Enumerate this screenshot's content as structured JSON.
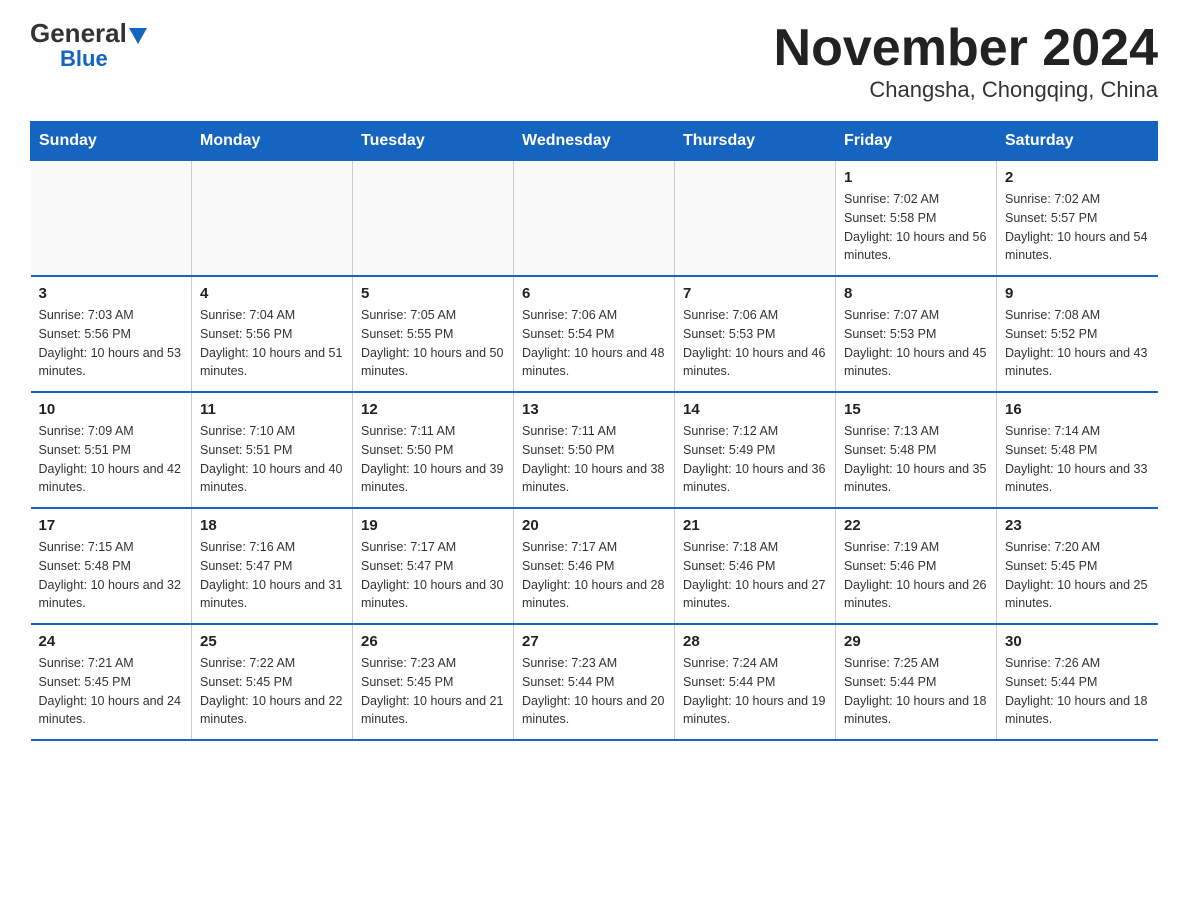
{
  "header": {
    "logo_general": "General",
    "logo_arrow": "",
    "logo_blue": "Blue",
    "title": "November 2024",
    "subtitle": "Changsha, Chongqing, China"
  },
  "weekdays": [
    "Sunday",
    "Monday",
    "Tuesday",
    "Wednesday",
    "Thursday",
    "Friday",
    "Saturday"
  ],
  "weeks": [
    [
      {
        "day": "",
        "info": ""
      },
      {
        "day": "",
        "info": ""
      },
      {
        "day": "",
        "info": ""
      },
      {
        "day": "",
        "info": ""
      },
      {
        "day": "",
        "info": ""
      },
      {
        "day": "1",
        "info": "Sunrise: 7:02 AM\nSunset: 5:58 PM\nDaylight: 10 hours and 56 minutes."
      },
      {
        "day": "2",
        "info": "Sunrise: 7:02 AM\nSunset: 5:57 PM\nDaylight: 10 hours and 54 minutes."
      }
    ],
    [
      {
        "day": "3",
        "info": "Sunrise: 7:03 AM\nSunset: 5:56 PM\nDaylight: 10 hours and 53 minutes."
      },
      {
        "day": "4",
        "info": "Sunrise: 7:04 AM\nSunset: 5:56 PM\nDaylight: 10 hours and 51 minutes."
      },
      {
        "day": "5",
        "info": "Sunrise: 7:05 AM\nSunset: 5:55 PM\nDaylight: 10 hours and 50 minutes."
      },
      {
        "day": "6",
        "info": "Sunrise: 7:06 AM\nSunset: 5:54 PM\nDaylight: 10 hours and 48 minutes."
      },
      {
        "day": "7",
        "info": "Sunrise: 7:06 AM\nSunset: 5:53 PM\nDaylight: 10 hours and 46 minutes."
      },
      {
        "day": "8",
        "info": "Sunrise: 7:07 AM\nSunset: 5:53 PM\nDaylight: 10 hours and 45 minutes."
      },
      {
        "day": "9",
        "info": "Sunrise: 7:08 AM\nSunset: 5:52 PM\nDaylight: 10 hours and 43 minutes."
      }
    ],
    [
      {
        "day": "10",
        "info": "Sunrise: 7:09 AM\nSunset: 5:51 PM\nDaylight: 10 hours and 42 minutes."
      },
      {
        "day": "11",
        "info": "Sunrise: 7:10 AM\nSunset: 5:51 PM\nDaylight: 10 hours and 40 minutes."
      },
      {
        "day": "12",
        "info": "Sunrise: 7:11 AM\nSunset: 5:50 PM\nDaylight: 10 hours and 39 minutes."
      },
      {
        "day": "13",
        "info": "Sunrise: 7:11 AM\nSunset: 5:50 PM\nDaylight: 10 hours and 38 minutes."
      },
      {
        "day": "14",
        "info": "Sunrise: 7:12 AM\nSunset: 5:49 PM\nDaylight: 10 hours and 36 minutes."
      },
      {
        "day": "15",
        "info": "Sunrise: 7:13 AM\nSunset: 5:48 PM\nDaylight: 10 hours and 35 minutes."
      },
      {
        "day": "16",
        "info": "Sunrise: 7:14 AM\nSunset: 5:48 PM\nDaylight: 10 hours and 33 minutes."
      }
    ],
    [
      {
        "day": "17",
        "info": "Sunrise: 7:15 AM\nSunset: 5:48 PM\nDaylight: 10 hours and 32 minutes."
      },
      {
        "day": "18",
        "info": "Sunrise: 7:16 AM\nSunset: 5:47 PM\nDaylight: 10 hours and 31 minutes."
      },
      {
        "day": "19",
        "info": "Sunrise: 7:17 AM\nSunset: 5:47 PM\nDaylight: 10 hours and 30 minutes."
      },
      {
        "day": "20",
        "info": "Sunrise: 7:17 AM\nSunset: 5:46 PM\nDaylight: 10 hours and 28 minutes."
      },
      {
        "day": "21",
        "info": "Sunrise: 7:18 AM\nSunset: 5:46 PM\nDaylight: 10 hours and 27 minutes."
      },
      {
        "day": "22",
        "info": "Sunrise: 7:19 AM\nSunset: 5:46 PM\nDaylight: 10 hours and 26 minutes."
      },
      {
        "day": "23",
        "info": "Sunrise: 7:20 AM\nSunset: 5:45 PM\nDaylight: 10 hours and 25 minutes."
      }
    ],
    [
      {
        "day": "24",
        "info": "Sunrise: 7:21 AM\nSunset: 5:45 PM\nDaylight: 10 hours and 24 minutes."
      },
      {
        "day": "25",
        "info": "Sunrise: 7:22 AM\nSunset: 5:45 PM\nDaylight: 10 hours and 22 minutes."
      },
      {
        "day": "26",
        "info": "Sunrise: 7:23 AM\nSunset: 5:45 PM\nDaylight: 10 hours and 21 minutes."
      },
      {
        "day": "27",
        "info": "Sunrise: 7:23 AM\nSunset: 5:44 PM\nDaylight: 10 hours and 20 minutes."
      },
      {
        "day": "28",
        "info": "Sunrise: 7:24 AM\nSunset: 5:44 PM\nDaylight: 10 hours and 19 minutes."
      },
      {
        "day": "29",
        "info": "Sunrise: 7:25 AM\nSunset: 5:44 PM\nDaylight: 10 hours and 18 minutes."
      },
      {
        "day": "30",
        "info": "Sunrise: 7:26 AM\nSunset: 5:44 PM\nDaylight: 10 hours and 18 minutes."
      }
    ]
  ]
}
